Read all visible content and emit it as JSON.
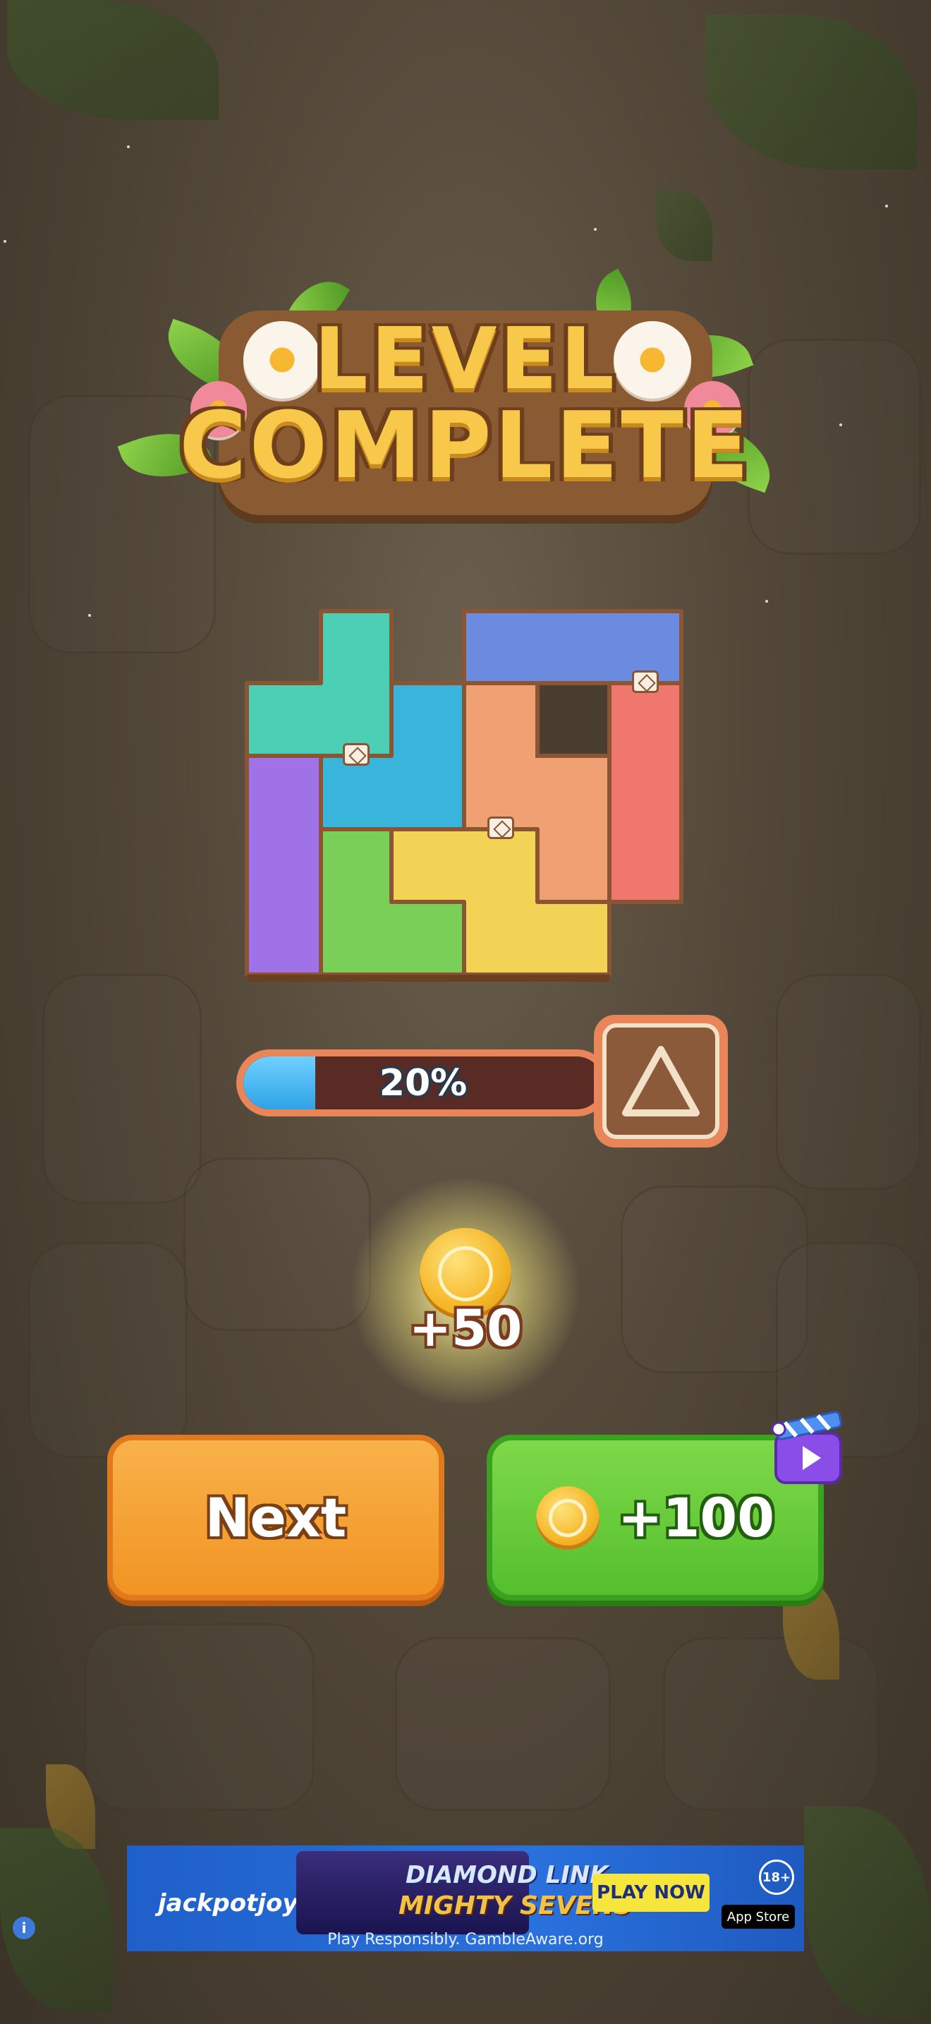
{
  "title": {
    "line1": "LEVEL",
    "line2": "COMPLETE"
  },
  "progress": {
    "label": "20%",
    "value": 0.2
  },
  "reward": {
    "amount": "+50"
  },
  "buttons": {
    "next_label": "Next",
    "bonus_label": "+100"
  },
  "ad": {
    "brand": "jackpotjoy",
    "game_title_line1": "DIAMOND LINK",
    "game_title_line2": "MIGHTY SEVENS",
    "play_label": "PLAY NOW",
    "age_badge": "18+",
    "store_label": "App Store",
    "disclaimer": "Play Responsibly. GambleAware.org"
  },
  "colors": {
    "background": "#524738",
    "puzzle_teal": "#4ccfb4",
    "puzzle_blue": "#6b8be0",
    "puzzle_sky": "#39b4da",
    "puzzle_orange": "#f0a073",
    "puzzle_red": "#ef776e",
    "puzzle_purple": "#9f72e8",
    "puzzle_green": "#79cf58",
    "puzzle_yellow": "#f2d356",
    "next_button": "#f19423",
    "bonus_button": "#54bf2d"
  },
  "icons": {
    "next_piece": "triangle-icon",
    "reward": "coin-icon",
    "video": "video-ad-icon",
    "info": "info-icon"
  }
}
